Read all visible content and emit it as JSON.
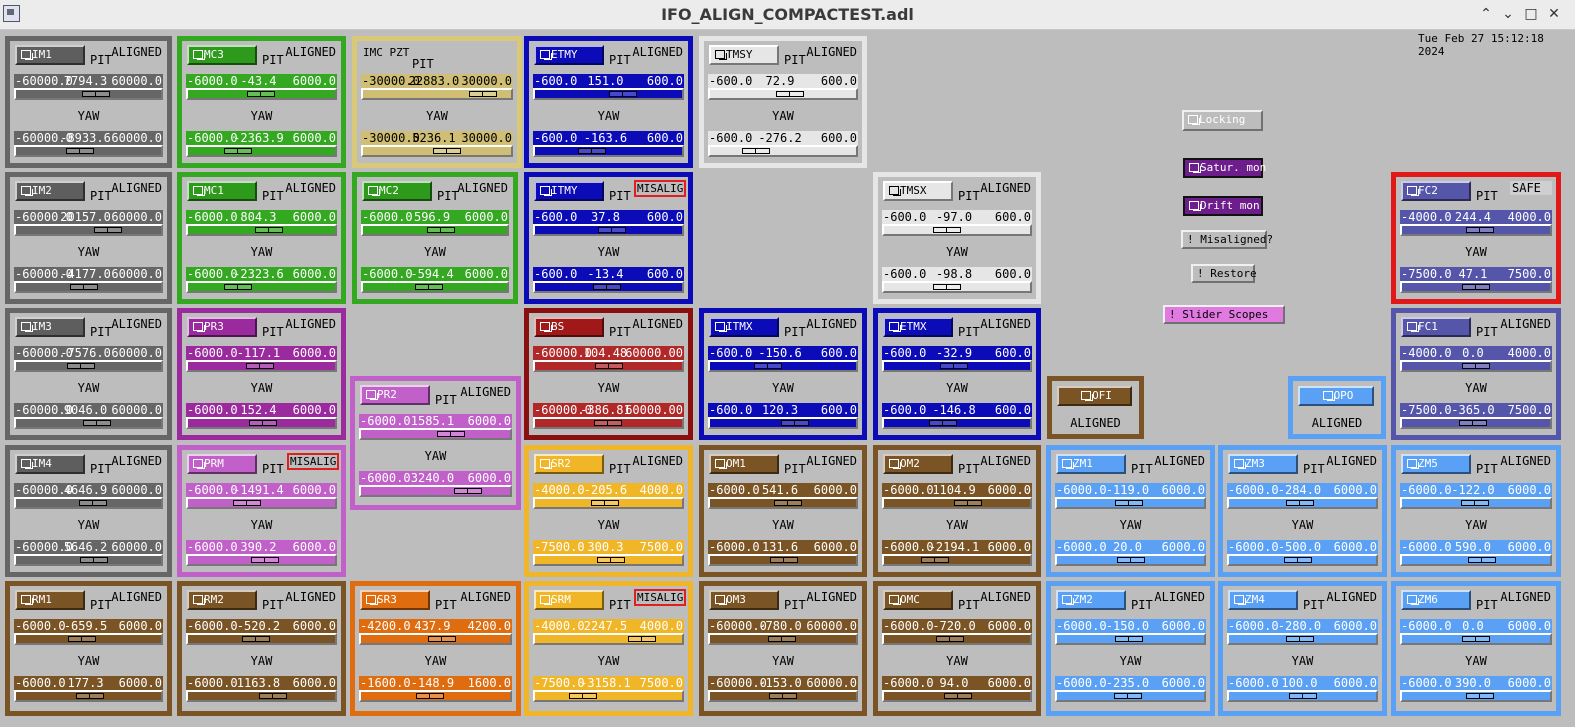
{
  "window": {
    "title": "IFO_ALIGN_COMPACTEST.adl",
    "timestamp": "Tue Feb 27 15:12:18 2024"
  },
  "labels": {
    "pit": "PIT",
    "yaw": "YAW"
  },
  "buttons": {
    "locking": "Locking",
    "satur_mon": "Satur. mon",
    "drift_mon": "Drift mon",
    "misaligned": "! Misaligned?",
    "restore": "! Restore",
    "slider_scopes": "! Slider Scopes"
  },
  "panels": [
    {
      "name": "IM1",
      "status": "ALIGNED",
      "mis": false,
      "pit": [
        "-60000.0",
        "7794.3",
        "60000.0"
      ],
      "yaw": [
        "-60000.0",
        "-8933.6",
        "60000.0"
      ],
      "pit_frac": 0.565,
      "yaw_frac": 0.426,
      "color": "#666666",
      "bg": "#666666",
      "btnbg": "#5e5e5e"
    },
    {
      "name": "MC3",
      "status": "ALIGNED",
      "mis": false,
      "pit": [
        "-6000.0",
        "-43.4",
        "6000.0"
      ],
      "yaw": [
        "-6000.0",
        "-2363.9",
        "6000.0"
      ],
      "pit_frac": 0.496,
      "yaw_frac": 0.303,
      "color": "#33a820",
      "bg": "#33a820",
      "btnbg": "#2e9a1c"
    },
    {
      "name": "IMC PZT",
      "status": "",
      "mis": false,
      "pit": [
        "-30000.0",
        "22883.0",
        "30000.0"
      ],
      "yaw": [
        "-30000.0",
        "5236.1",
        "30000.0"
      ],
      "pit_frac": 0.881,
      "yaw_frac": 0.587,
      "color": "#d8c878",
      "bg": "#cfbe74",
      "btnbg": "#cfbe74"
    },
    {
      "name": "ETMY",
      "status": "ALIGNED",
      "mis": false,
      "pit": [
        "-600.0",
        "151.0",
        "600.0"
      ],
      "yaw": [
        "-600.0",
        "-163.6",
        "600.0"
      ],
      "pit_frac": 0.626,
      "yaw_frac": 0.364,
      "color": "#0b0bb8",
      "bg": "#0b0bb8",
      "btnbg": "#0b0bb8"
    },
    {
      "name": "TMSY",
      "status": "ALIGNED",
      "mis": false,
      "pit": [
        "-600.0",
        "72.9",
        "600.0"
      ],
      "yaw": [
        "-600.0",
        "-276.2",
        "600.0"
      ],
      "pit_frac": 0.561,
      "yaw_frac": 0.27,
      "color": "#e6e6e6",
      "bg": "#e6e6e6",
      "btnbg": "#e6e6e6"
    },
    {
      "name": "IM2",
      "status": "ALIGNED",
      "mis": false,
      "pit": [
        "-60000.0",
        "20157.0",
        "60000.0"
      ],
      "yaw": [
        "-60000.0",
        "-4177.0",
        "60000.0"
      ],
      "pit_frac": 0.668,
      "yaw_frac": 0.465,
      "color": "#666666",
      "bg": "#666666",
      "btnbg": "#5e5e5e"
    },
    {
      "name": "MC1",
      "status": "ALIGNED",
      "mis": false,
      "pit": [
        "-6000.0",
        "804.3",
        "6000.0"
      ],
      "yaw": [
        "-6000.0",
        "-2323.6",
        "6000.0"
      ],
      "pit_frac": 0.567,
      "yaw_frac": 0.306,
      "color": "#33a820",
      "bg": "#33a820",
      "btnbg": "#2e9a1c"
    },
    {
      "name": "MC2",
      "status": "ALIGNED",
      "mis": false,
      "pit": [
        "-6000.0",
        "596.9",
        "6000.0"
      ],
      "yaw": [
        "-6000.0",
        "-594.4",
        "6000.0"
      ],
      "pit_frac": 0.55,
      "yaw_frac": 0.45,
      "color": "#33a820",
      "bg": "#33a820",
      "btnbg": "#2e9a1c"
    },
    {
      "name": "ITMY",
      "status": "MISALIGN",
      "mis": true,
      "pit": [
        "-600.0",
        "37.8",
        "600.0"
      ],
      "yaw": [
        "-600.0",
        "-13.4",
        "600.0"
      ],
      "pit_frac": 0.531,
      "yaw_frac": 0.489,
      "color": "#0b0bb8",
      "bg": "#0b0bb8",
      "btnbg": "#0b0bb8"
    },
    {
      "name": "TMSX",
      "status": "ALIGNED",
      "mis": false,
      "pit": [
        "-600.0",
        "-97.0",
        "600.0"
      ],
      "yaw": [
        "-600.0",
        "-98.8",
        "600.0"
      ],
      "pit_frac": 0.419,
      "yaw_frac": 0.418,
      "color": "#e6e6e6",
      "bg": "#e6e6e6",
      "btnbg": "#e6e6e6"
    },
    {
      "name": "FC2",
      "status": "SAFE",
      "mis": false,
      "pit": [
        "-4000.0",
        "244.4",
        "4000.0"
      ],
      "yaw": [
        "-7500.0",
        "47.1",
        "7500.0"
      ],
      "pit_frac": 0.531,
      "yaw_frac": 0.503,
      "color": "#e01818",
      "bg": "#5555aa",
      "btnbg": "#5555aa"
    },
    {
      "name": "IM3",
      "status": "ALIGNED",
      "mis": false,
      "pit": [
        "-60000.0",
        "-7576.0",
        "60000.0"
      ],
      "yaw": [
        "-60000.0",
        "9046.0",
        "60000.0"
      ],
      "pit_frac": 0.437,
      "yaw_frac": 0.575,
      "color": "#666666",
      "bg": "#666666",
      "btnbg": "#5e5e5e"
    },
    {
      "name": "PR3",
      "status": "ALIGNED",
      "mis": false,
      "pit": [
        "-6000.0",
        "-117.1",
        "6000.0"
      ],
      "yaw": [
        "-6000.0",
        "152.4",
        "6000.0"
      ],
      "pit_frac": 0.49,
      "yaw_frac": 0.513,
      "color": "#9a2a9e",
      "bg": "#9a2a9e",
      "btnbg": "#9a2a9e"
    },
    {
      "name": "BS",
      "status": "ALIGNED",
      "mis": false,
      "pit": [
        "-60000.0",
        "104.48",
        "60000.00"
      ],
      "yaw": [
        "-60000.0",
        "-386.81",
        "60000.00"
      ],
      "pit_frac": 0.501,
      "yaw_frac": 0.497,
      "color": "#8a1010",
      "bg": "#b02828",
      "btnbg": "#a01818"
    },
    {
      "name": "ITMX",
      "status": "ALIGNED",
      "mis": false,
      "pit": [
        "-600.0",
        "-150.6",
        "600.0"
      ],
      "yaw": [
        "-600.0",
        "120.3",
        "600.0"
      ],
      "pit_frac": 0.375,
      "yaw_frac": 0.6,
      "color": "#0b0bb8",
      "bg": "#0b0bb8",
      "btnbg": "#0b0bb8"
    },
    {
      "name": "ETMX",
      "status": "ALIGNED",
      "mis": false,
      "pit": [
        "-600.0",
        "-32.9",
        "600.0"
      ],
      "yaw": [
        "-600.0",
        "-146.8",
        "600.0"
      ],
      "pit_frac": 0.473,
      "yaw_frac": 0.378,
      "color": "#0b0bb8",
      "bg": "#0b0bb8",
      "btnbg": "#0b0bb8"
    },
    {
      "name": "FC1",
      "status": "ALIGNED",
      "mis": false,
      "pit": [
        "-4000.0",
        "0.0",
        "4000.0"
      ],
      "yaw": [
        "-7500.0",
        "-365.0",
        "7500.0"
      ],
      "pit_frac": 0.5,
      "yaw_frac": 0.476,
      "color": "#5555aa",
      "bg": "#5555aa",
      "btnbg": "#5555aa"
    },
    {
      "name": "PR2",
      "status": "ALIGNED",
      "mis": false,
      "pit": [
        "-6000.0",
        "1585.1",
        "6000.0"
      ],
      "yaw": [
        "-6000.0",
        "3240.0",
        "6000.0"
      ],
      "pit_frac": 0.632,
      "yaw_frac": 0.77,
      "color": "#c060c8",
      "bg": "#c060c8",
      "btnbg": "#c060c8"
    },
    {
      "name": "IM4",
      "status": "ALIGNED",
      "mis": false,
      "pit": [
        "-60000.0",
        "4646.9",
        "60000.0"
      ],
      "yaw": [
        "-60000.0",
        "5646.2",
        "60000.0"
      ],
      "pit_frac": 0.539,
      "yaw_frac": 0.547,
      "color": "#666666",
      "bg": "#666666",
      "btnbg": "#5e5e5e"
    },
    {
      "name": "PRM",
      "status": "MISALIGN",
      "mis": true,
      "pit": [
        "-6000.0",
        "-1491.4",
        "6000.0"
      ],
      "yaw": [
        "-6000.0",
        "390.2",
        "6000.0"
      ],
      "pit_frac": 0.376,
      "yaw_frac": 0.533,
      "color": "#c060c8",
      "bg": "#c060c8",
      "btnbg": "#c060c8"
    },
    {
      "name": "SR2",
      "status": "ALIGNED",
      "mis": false,
      "pit": [
        "-4000.0",
        "-205.6",
        "4000.0"
      ],
      "yaw": [
        "-7500.0",
        "300.3",
        "7500.0"
      ],
      "pit_frac": 0.474,
      "yaw_frac": 0.52,
      "color": "#f0b628",
      "bg": "#f0b628",
      "btnbg": "#f0b628"
    },
    {
      "name": "OM1",
      "status": "ALIGNED",
      "mis": false,
      "pit": [
        "-6000.0",
        "541.6",
        "6000.0"
      ],
      "yaw": [
        "-6000.0",
        "131.6",
        "6000.0"
      ],
      "pit_frac": 0.545,
      "yaw_frac": 0.511,
      "color": "#7a5424",
      "bg": "#7a5424",
      "btnbg": "#7a5424"
    },
    {
      "name": "OM2",
      "status": "ALIGNED",
      "mis": false,
      "pit": [
        "-6000.0",
        "1104.9",
        "6000.0"
      ],
      "yaw": [
        "-6000.0",
        "-2194.1",
        "6000.0"
      ],
      "pit_frac": 0.592,
      "yaw_frac": 0.317,
      "color": "#7a5424",
      "bg": "#7a5424",
      "btnbg": "#7a5424"
    },
    {
      "name": "ZM1",
      "status": "ALIGNED",
      "mis": false,
      "pit": [
        "-6000.0",
        "-119.0",
        "6000.0"
      ],
      "yaw": [
        "-6000.0",
        "20.0",
        "6000.0"
      ],
      "pit_frac": 0.49,
      "yaw_frac": 0.502,
      "color": "#5aa0f5",
      "bg": "#5aa0f5",
      "btnbg": "#5aa0f5"
    },
    {
      "name": "ZM3",
      "status": "ALIGNED",
      "mis": false,
      "pit": [
        "-6000.0",
        "-284.0",
        "6000.0"
      ],
      "yaw": [
        "-6000.0",
        "-500.0",
        "6000.0"
      ],
      "pit_frac": 0.476,
      "yaw_frac": 0.458,
      "color": "#5aa0f5",
      "bg": "#5aa0f5",
      "btnbg": "#5aa0f5"
    },
    {
      "name": "ZM5",
      "status": "ALIGNED",
      "mis": false,
      "pit": [
        "-6000.0",
        "-122.0",
        "6000.0"
      ],
      "yaw": [
        "-6000.0",
        "590.0",
        "6000.0"
      ],
      "pit_frac": 0.49,
      "yaw_frac": 0.549,
      "color": "#5aa0f5",
      "bg": "#5aa0f5",
      "btnbg": "#5aa0f5"
    },
    {
      "name": "RM1",
      "status": "ALIGNED",
      "mis": false,
      "pit": [
        "-6000.0",
        "-659.5",
        "6000.0"
      ],
      "yaw": [
        "-6000.0",
        "177.3",
        "6000.0"
      ],
      "pit_frac": 0.445,
      "yaw_frac": 0.515,
      "color": "#7a5424",
      "bg": "#7a5424",
      "btnbg": "#7a5424"
    },
    {
      "name": "RM2",
      "status": "ALIGNED",
      "mis": false,
      "pit": [
        "-6000.0",
        "-520.2",
        "6000.0"
      ],
      "yaw": [
        "-6000.0",
        "1163.8",
        "6000.0"
      ],
      "pit_frac": 0.457,
      "yaw_frac": 0.597,
      "color": "#7a5424",
      "bg": "#7a5424",
      "btnbg": "#7a5424"
    },
    {
      "name": "SR3",
      "status": "ALIGNED",
      "mis": false,
      "pit": [
        "-4200.0",
        "437.9",
        "4200.0"
      ],
      "yaw": [
        "-1600.0",
        "-148.9",
        "1600.0"
      ],
      "pit_frac": 0.552,
      "yaw_frac": 0.453,
      "color": "#e06c10",
      "bg": "#e06c10",
      "btnbg": "#e06c10"
    },
    {
      "name": "SRM",
      "status": "MISALIGN",
      "mis": true,
      "pit": [
        "-4000.0",
        "2247.5",
        "4000.0"
      ],
      "yaw": [
        "-7500.0",
        "-3158.1",
        "7500.0"
      ],
      "pit_frac": 0.781,
      "yaw_frac": 0.289,
      "color": "#f0b628",
      "bg": "#f0b628",
      "btnbg": "#f0b628"
    },
    {
      "name": "OM3",
      "status": "ALIGNED",
      "mis": false,
      "pit": [
        "-60000.0",
        "-780.0",
        "60000.0"
      ],
      "yaw": [
        "-60000.0",
        "-153.0",
        "60000.0"
      ],
      "pit_frac": 0.494,
      "yaw_frac": 0.499,
      "color": "#7a5424",
      "bg": "#7a5424",
      "btnbg": "#7a5424"
    },
    {
      "name": "OMC",
      "status": "ALIGNED",
      "mis": false,
      "pit": [
        "-6000.0",
        "-720.0",
        "6000.0"
      ],
      "yaw": [
        "-6000.0",
        "94.0",
        "6000.0"
      ],
      "pit_frac": 0.44,
      "yaw_frac": 0.508,
      "color": "#7a5424",
      "bg": "#7a5424",
      "btnbg": "#7a5424"
    },
    {
      "name": "ZM2",
      "status": "ALIGNED",
      "mis": false,
      "pit": [
        "-6000.0",
        "-150.0",
        "6000.0"
      ],
      "yaw": [
        "-6000.0",
        "-235.0",
        "6000.0"
      ],
      "pit_frac": 0.488,
      "yaw_frac": 0.48,
      "color": "#5aa0f5",
      "bg": "#5aa0f5",
      "btnbg": "#5aa0f5"
    },
    {
      "name": "ZM4",
      "status": "ALIGNED",
      "mis": false,
      "pit": [
        "-6000.0",
        "-280.0",
        "6000.0"
      ],
      "yaw": [
        "-6000.0",
        "100.0",
        "6000.0"
      ],
      "pit_frac": 0.477,
      "yaw_frac": 0.508,
      "color": "#5aa0f5",
      "bg": "#5aa0f5",
      "btnbg": "#5aa0f5"
    },
    {
      "name": "ZM6",
      "status": "ALIGNED",
      "mis": false,
      "pit": [
        "-6000.0",
        "0.0",
        "6000.0"
      ],
      "yaw": [
        "-6000.0",
        "390.0",
        "6000.0"
      ],
      "pit_frac": 0.5,
      "yaw_frac": 0.533,
      "color": "#5aa0f5",
      "bg": "#5aa0f5",
      "btnbg": "#5aa0f5"
    }
  ],
  "small_panels": [
    {
      "name": "OFI",
      "status": "ALIGNED",
      "color": "#7a5424"
    },
    {
      "name": "OPO",
      "status": "ALIGNED",
      "color": "#5aa0f5"
    }
  ]
}
